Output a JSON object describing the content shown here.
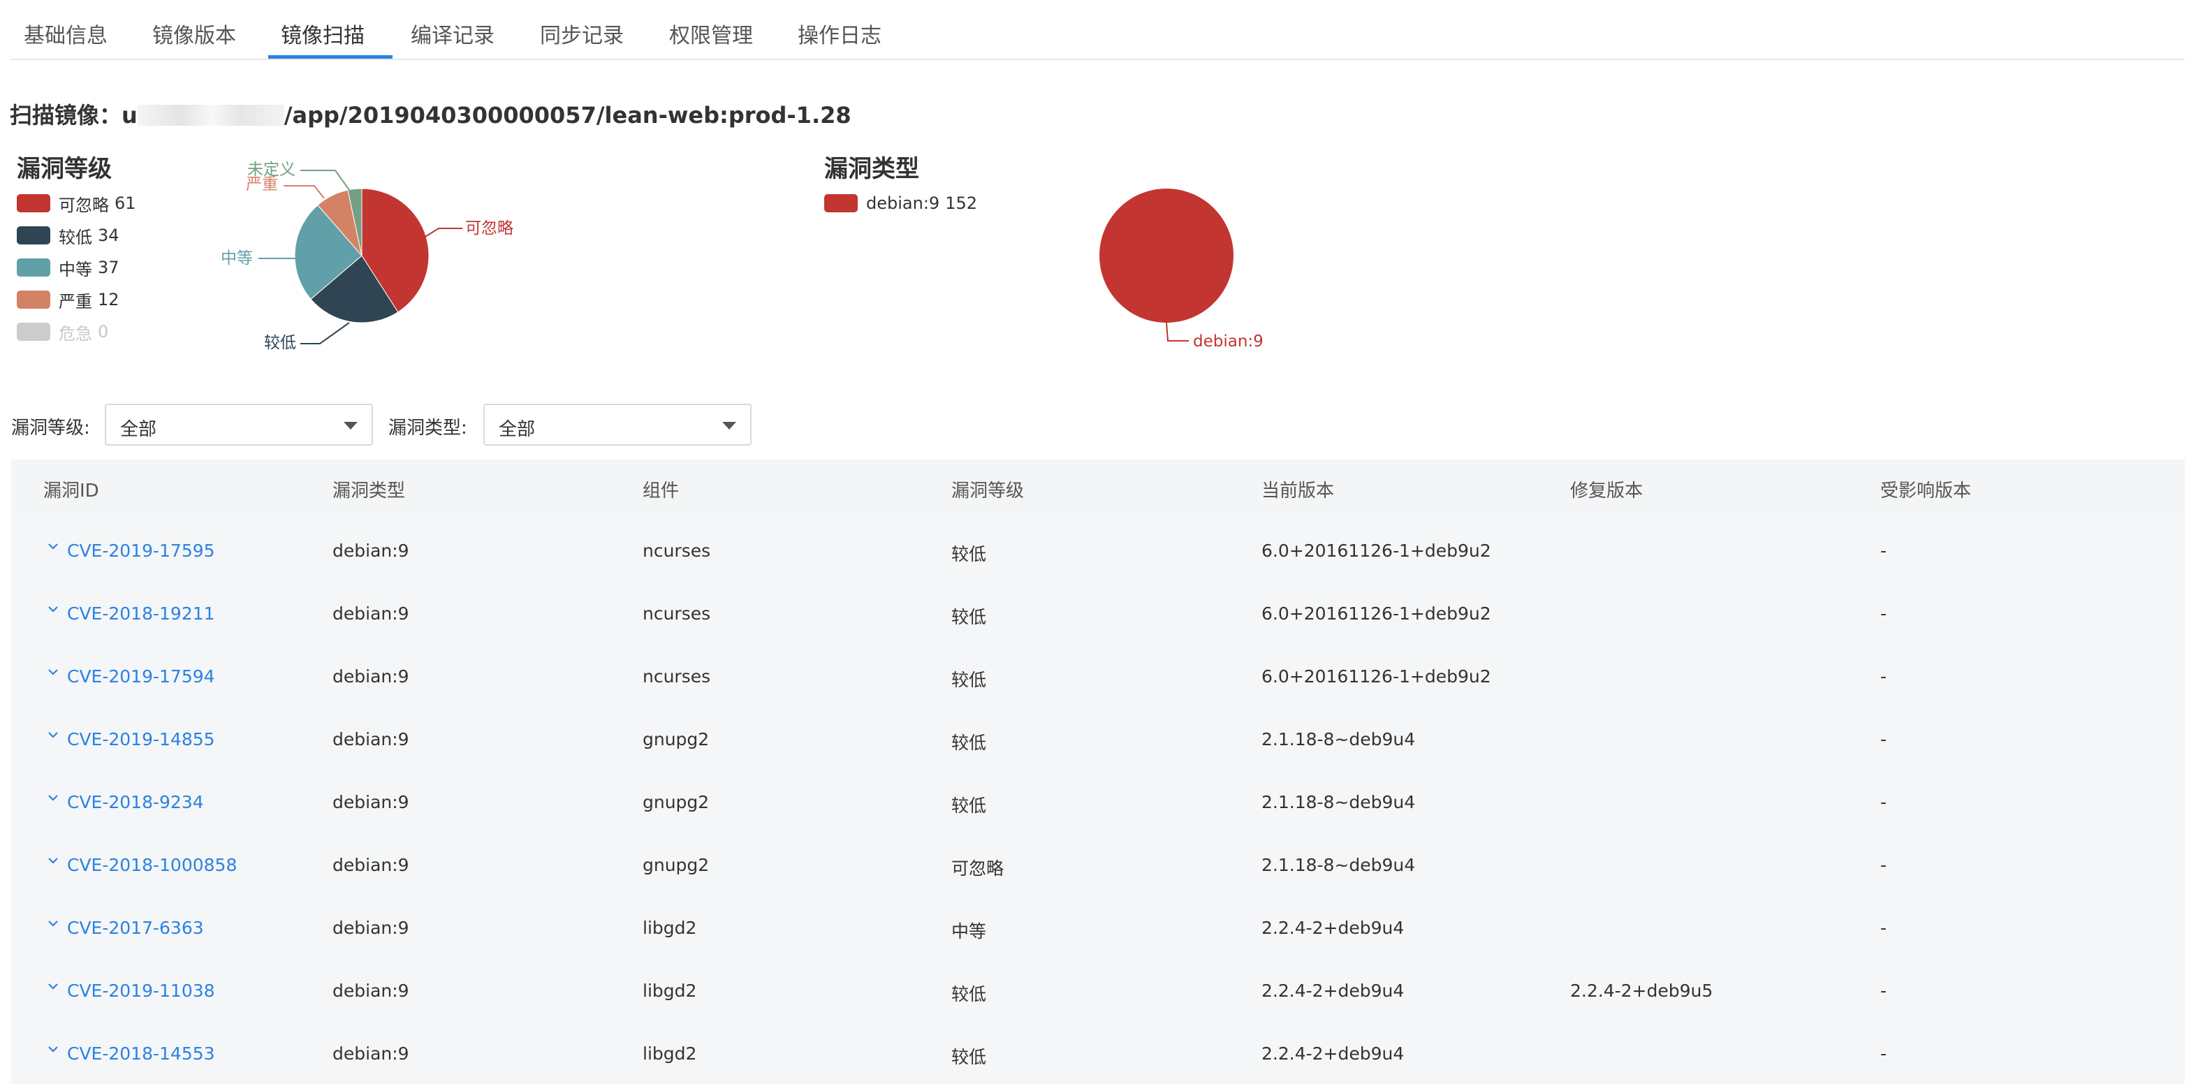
{
  "tabs": [
    {
      "label": "基础信息",
      "active": false
    },
    {
      "label": "镜像版本",
      "active": false
    },
    {
      "label": "镜像扫描",
      "active": true
    },
    {
      "label": "编译记录",
      "active": false
    },
    {
      "label": "同步记录",
      "active": false
    },
    {
      "label": "权限管理",
      "active": false
    },
    {
      "label": "操作日志",
      "active": false
    }
  ],
  "scan": {
    "prefix": "扫描镜像：",
    "image_visible": "u",
    "image_suffix": "/app/2019040300000057/lean-web:prod-1.28"
  },
  "level_chart": {
    "title": "漏洞等级",
    "legend": [
      {
        "label": "可忽略",
        "count": "61"
      },
      {
        "label": "较低",
        "count": "34"
      },
      {
        "label": "中等",
        "count": "37"
      },
      {
        "label": "严重",
        "count": "12"
      },
      {
        "label": "危急",
        "count": "0"
      }
    ],
    "slice_labels": [
      "可忽略",
      "较低",
      "中等",
      "严重",
      "未定义"
    ]
  },
  "type_chart": {
    "title": "漏洞类型",
    "legend": [
      {
        "label": "debian:9",
        "count": "152"
      }
    ],
    "slice_label": "debian:9"
  },
  "chart_data": [
    {
      "type": "pie",
      "title": "漏洞等级",
      "categories": [
        "可忽略",
        "较低",
        "中等",
        "严重",
        "危急",
        "未定义"
      ],
      "values": [
        61,
        34,
        37,
        12,
        0,
        5
      ],
      "colors": [
        "#c23531",
        "#2f4554",
        "#61a0a8",
        "#d48265",
        "#cccccc",
        "#749f83"
      ],
      "hidden": [
        "危急"
      ],
      "legend": "left"
    },
    {
      "type": "pie",
      "title": "漏洞类型",
      "categories": [
        "debian:9"
      ],
      "values": [
        152
      ],
      "colors": [
        "#c23531"
      ],
      "legend": "left"
    }
  ],
  "filters": {
    "level_label": "漏洞等级:",
    "level_value": "全部",
    "type_label": "漏洞类型:",
    "type_value": "全部"
  },
  "table": {
    "headers": [
      "漏洞ID",
      "漏洞类型",
      "组件",
      "漏洞等级",
      "当前版本",
      "修复版本",
      "受影响版本"
    ],
    "rows": [
      {
        "id": "CVE-2019-17595",
        "type": "debian:9",
        "component": "ncurses",
        "level": "较低",
        "current": "6.0+20161126-1+deb9u2",
        "fixed": "",
        "affected": "-"
      },
      {
        "id": "CVE-2018-19211",
        "type": "debian:9",
        "component": "ncurses",
        "level": "较低",
        "current": "6.0+20161126-1+deb9u2",
        "fixed": "",
        "affected": "-"
      },
      {
        "id": "CVE-2019-17594",
        "type": "debian:9",
        "component": "ncurses",
        "level": "较低",
        "current": "6.0+20161126-1+deb9u2",
        "fixed": "",
        "affected": "-"
      },
      {
        "id": "CVE-2019-14855",
        "type": "debian:9",
        "component": "gnupg2",
        "level": "较低",
        "current": "2.1.18-8~deb9u4",
        "fixed": "",
        "affected": "-"
      },
      {
        "id": "CVE-2018-9234",
        "type": "debian:9",
        "component": "gnupg2",
        "level": "较低",
        "current": "2.1.18-8~deb9u4",
        "fixed": "",
        "affected": "-"
      },
      {
        "id": "CVE-2018-1000858",
        "type": "debian:9",
        "component": "gnupg2",
        "level": "可忽略",
        "current": "2.1.18-8~deb9u4",
        "fixed": "",
        "affected": "-"
      },
      {
        "id": "CVE-2017-6363",
        "type": "debian:9",
        "component": "libgd2",
        "level": "中等",
        "current": "2.2.4-2+deb9u4",
        "fixed": "",
        "affected": "-"
      },
      {
        "id": "CVE-2019-11038",
        "type": "debian:9",
        "component": "libgd2",
        "level": "较低",
        "current": "2.2.4-2+deb9u4",
        "fixed": "2.2.4-2+deb9u5",
        "affected": "-"
      },
      {
        "id": "CVE-2018-14553",
        "type": "debian:9",
        "component": "libgd2",
        "level": "较低",
        "current": "2.2.4-2+deb9u4",
        "fixed": "",
        "affected": "-"
      }
    ]
  }
}
